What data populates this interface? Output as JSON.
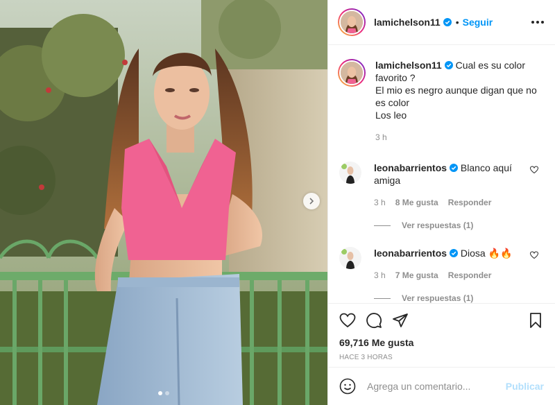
{
  "colors": {
    "accent": "#0095f6",
    "text": "#262626",
    "muted": "#8e8e8e",
    "publish_disabled": "#b2dffc",
    "shirt": "#f06292"
  },
  "media": {
    "slide_count": 2,
    "active_slide": 1,
    "next_icon": "chevron-right-icon"
  },
  "header": {
    "username": "lamichelson11",
    "follow_label": "Seguir",
    "dot": "•"
  },
  "caption": {
    "username": "lamichelson11",
    "lines": [
      "Cual es su color",
      "favorito ?",
      "El mio es negro aunque digan que no",
      "es color",
      "Los leo"
    ],
    "time": "3 h"
  },
  "comments": [
    {
      "username": "leonabarrientos",
      "text_lines": [
        "Blanco aquí",
        "amiga"
      ],
      "time": "3 h",
      "likes": "8 Me gusta",
      "reply": "Responder",
      "view_replies": "Ver respuestas (1)"
    },
    {
      "username": "leonabarrientos",
      "text_lines": [
        "Diosa 🔥🔥"
      ],
      "time": "3 h",
      "likes": "7 Me gusta",
      "reply": "Responder",
      "view_replies": "Ver respuestas (1)"
    }
  ],
  "actions": {
    "likes": "69,716 Me gusta",
    "posted": "HACE 3 HORAS"
  },
  "add_comment": {
    "placeholder": "Agrega un comentario...",
    "publish_label": "Publicar"
  }
}
